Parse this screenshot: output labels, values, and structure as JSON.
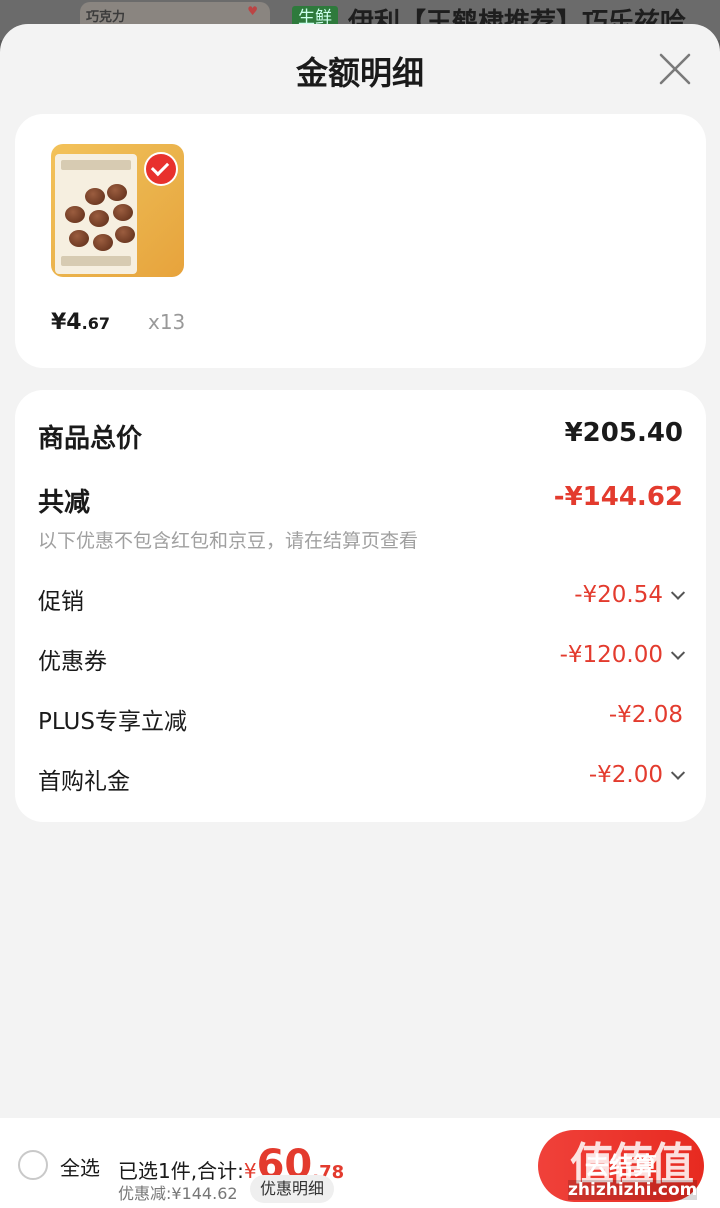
{
  "background": {
    "thumb_text": "巧克力",
    "tag": "生鲜",
    "title": "伊利【王鹤棣推荐】巧乐兹哈"
  },
  "sheet": {
    "title": "金额明细"
  },
  "product": {
    "price_int": "¥4",
    "price_dec": ".67",
    "qty": "x13",
    "image_label": "巧克力雪糕"
  },
  "price_detail": {
    "total_label": "商品总价",
    "total_value": "¥205.40",
    "reduce_label": "共减",
    "reduce_value": "-¥144.62",
    "hint": "以下优惠不包含红包和京豆，请在结算页查看",
    "items": [
      {
        "label": "促销",
        "value": "-¥20.54",
        "expandable": true
      },
      {
        "label": "优惠券",
        "value": "-¥120.00",
        "expandable": true
      },
      {
        "label": "PLUS专享立减",
        "value": "-¥2.08",
        "expandable": false
      },
      {
        "label": "首购礼金",
        "value": "-¥2.00",
        "expandable": true
      }
    ]
  },
  "bottom_bar": {
    "select_all": "全选",
    "selected_prefix": "已选1件,合计:",
    "currency": "¥",
    "total_int": "60",
    "total_dec": ".78",
    "discount": "优惠减:¥144.62",
    "detail_chip": "优惠明细",
    "checkout": "去结算"
  },
  "watermark": {
    "logo": "值值值",
    "site": "zhizhizhi.com"
  },
  "colors": {
    "accent_red": "#e33b2e",
    "sheet_bg": "#f3f3f3"
  }
}
